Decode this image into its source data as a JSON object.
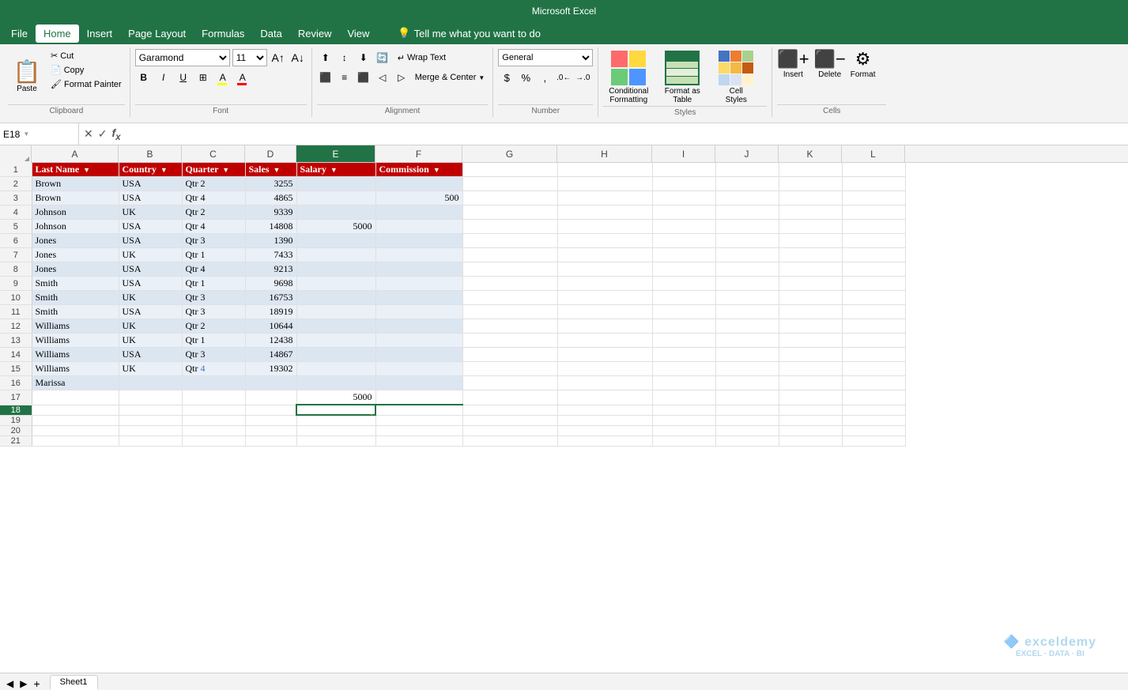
{
  "titleBar": {
    "title": "Microsoft Excel"
  },
  "menuBar": {
    "items": [
      "File",
      "Home",
      "Insert",
      "Page Layout",
      "Formulas",
      "Data",
      "Review",
      "View"
    ],
    "activeItem": "Home",
    "tellMe": "Tell me what you want to do"
  },
  "ribbon": {
    "clipboard": {
      "label": "Clipboard",
      "pasteLabel": "Paste",
      "cutLabel": "Cut",
      "copyLabel": "Copy",
      "formatPainterLabel": "Format Painter"
    },
    "font": {
      "label": "Font",
      "fontName": "Garamond",
      "fontSize": "11",
      "boldLabel": "B",
      "italicLabel": "I",
      "underlineLabel": "U"
    },
    "alignment": {
      "label": "Alignment",
      "wrapTextLabel": "Wrap Text",
      "mergeCenterLabel": "Merge & Center"
    },
    "number": {
      "label": "Number",
      "formatLabel": "General"
    },
    "styles": {
      "label": "Styles",
      "conditionalFormattingLabel": "Conditional Formatting",
      "formatAsTableLabel": "Format as Table",
      "cellStylesLabel": "Cell Styles"
    },
    "cells": {
      "label": "Cells",
      "insertLabel": "Insert",
      "deleteLabel": "Delete",
      "formatLabel": "Format"
    }
  },
  "formulaBar": {
    "cellRef": "E18",
    "formula": ""
  },
  "columns": {
    "widths": [
      40,
      110,
      80,
      80,
      65,
      100,
      110
    ],
    "labels": [
      "",
      "A",
      "B",
      "C",
      "D",
      "E",
      "F",
      "G",
      "H",
      "I",
      "J",
      "K",
      "L"
    ],
    "activeCol": "E"
  },
  "tableHeaders": {
    "A1": "Last Name",
    "B1": "Country",
    "C1": "Quarter",
    "D1": "Sales",
    "E1": "Salary",
    "F1": "Commission"
  },
  "tableData": [
    {
      "row": 2,
      "A": "Brown",
      "B": "USA",
      "C": "Qtr 2",
      "D": "3255",
      "E": "",
      "F": ""
    },
    {
      "row": 3,
      "A": "Brown",
      "B": "USA",
      "C": "Qtr 4",
      "D": "4865",
      "E": "",
      "F": "500"
    },
    {
      "row": 4,
      "A": "Johnson",
      "B": "UK",
      "C": "Qtr 2",
      "D": "9339",
      "E": "",
      "F": ""
    },
    {
      "row": 5,
      "A": "Johnson",
      "B": "USA",
      "C": "Qtr 4",
      "D": "14808",
      "E": "5000",
      "F": ""
    },
    {
      "row": 6,
      "A": "Jones",
      "B": "USA",
      "C": "Qtr 3",
      "D": "1390",
      "E": "",
      "F": ""
    },
    {
      "row": 7,
      "A": "Jones",
      "B": "UK",
      "C": "Qtr 1",
      "D": "7433",
      "E": "",
      "F": ""
    },
    {
      "row": 8,
      "A": "Jones",
      "B": "USA",
      "C": "Qtr 4",
      "D": "9213",
      "E": "",
      "F": ""
    },
    {
      "row": 9,
      "A": "Smith",
      "B": "USA",
      "C": "Qtr 1",
      "D": "9698",
      "E": "",
      "F": ""
    },
    {
      "row": 10,
      "A": "Smith",
      "B": "UK",
      "C": "Qtr 3",
      "D": "16753",
      "E": "",
      "F": ""
    },
    {
      "row": 11,
      "A": "Smith",
      "B": "USA",
      "C": "Qtr 3",
      "D": "18919",
      "E": "",
      "F": ""
    },
    {
      "row": 12,
      "A": "Williams",
      "B": "UK",
      "C": "Qtr 2",
      "D": "10644",
      "E": "",
      "F": ""
    },
    {
      "row": 13,
      "A": "Williams",
      "B": "UK",
      "C": "Qtr 1",
      "D": "12438",
      "E": "",
      "F": ""
    },
    {
      "row": 14,
      "A": "Williams",
      "B": "USA",
      "C": "Qtr 3",
      "D": "14867",
      "E": "",
      "F": ""
    },
    {
      "row": 15,
      "A": "Williams",
      "B": "UK",
      "C": "Qtr 4",
      "D": "19302",
      "E": "",
      "F": ""
    },
    {
      "row": 16,
      "A": "Marissa",
      "B": "",
      "C": "",
      "D": "",
      "E": "",
      "F": ""
    },
    {
      "row": 17,
      "A": "",
      "B": "",
      "C": "",
      "D": "",
      "E": "5000",
      "F": ""
    },
    {
      "row": 18,
      "A": "",
      "B": "",
      "C": "",
      "D": "",
      "E": "",
      "F": ""
    },
    {
      "row": 19,
      "A": "",
      "B": "",
      "C": "",
      "D": "",
      "E": "",
      "F": ""
    },
    {
      "row": 20,
      "A": "",
      "B": "",
      "C": "",
      "D": "",
      "E": "",
      "F": ""
    },
    {
      "row": 21,
      "A": "",
      "B": "",
      "C": "",
      "D": "",
      "E": "",
      "F": ""
    }
  ],
  "sheetTabs": {
    "tabs": [
      "Sheet1"
    ],
    "activeTab": "Sheet1"
  },
  "watermark": {
    "line1": "exceldemy",
    "line2": "EXCEL · DATA · BI"
  },
  "colors": {
    "excelGreen": "#217346",
    "tableHeaderRed": "#c00000",
    "tableRowEven": "#dce6f1",
    "tableRowOdd": "#e9f0f8",
    "selectedCell": "#217346"
  }
}
